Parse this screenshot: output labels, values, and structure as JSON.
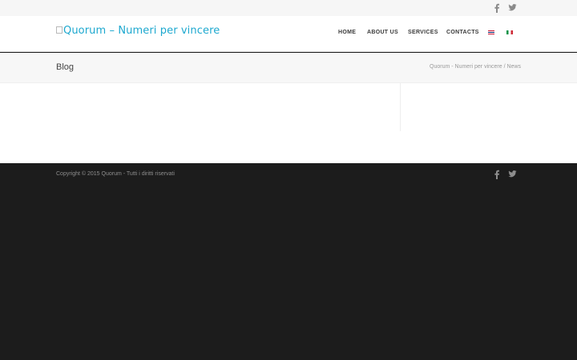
{
  "header": {
    "logo_alt": "Quorum – Numeri per vincere",
    "nav": [
      {
        "label": "HOME"
      },
      {
        "label": "ABOUT US"
      },
      {
        "label": "SERVICES"
      },
      {
        "label": "CONTACTS"
      }
    ],
    "languages": [
      {
        "icon": "flag-uk-icon"
      },
      {
        "icon": "flag-italy-icon"
      }
    ]
  },
  "topbar": {
    "social": [
      {
        "icon": "facebook-icon"
      },
      {
        "icon": "twitter-icon"
      }
    ]
  },
  "title_bar": {
    "title": "Blog",
    "breadcrumb": "Quorum - Numeri per vincere / News"
  },
  "footer": {
    "copyright": "Copyright © 2015 Quorum - Tutti i diritti riservati",
    "social": [
      {
        "icon": "facebook-icon"
      },
      {
        "icon": "twitter-icon"
      }
    ]
  },
  "colors": {
    "brand": "#1da8cf",
    "footer_bg": "#1c1c1c",
    "topbar_bg": "#f6f6f6"
  }
}
